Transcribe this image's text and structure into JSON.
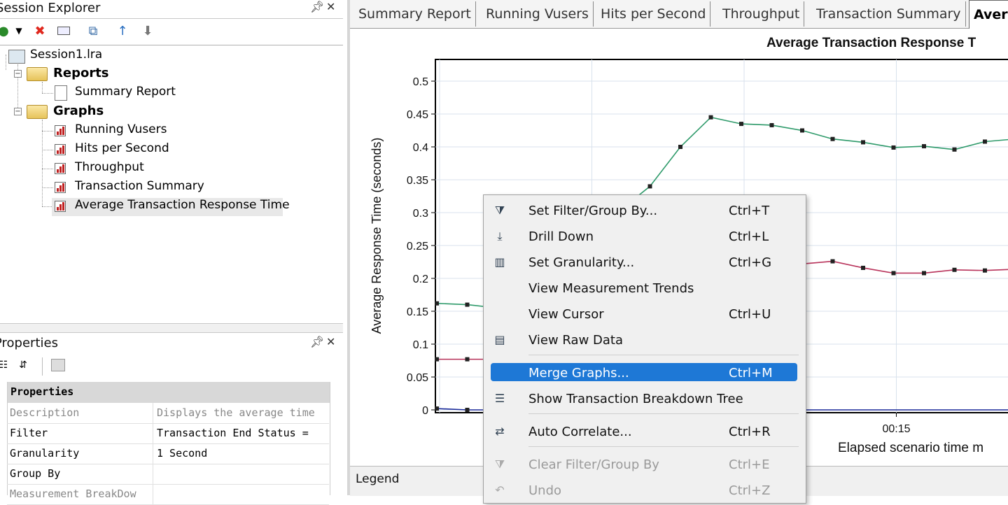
{
  "session_explorer": {
    "title": "Session Explorer",
    "tree": {
      "session": "Session1.lra",
      "reports_label": "Reports",
      "reports": [
        "Summary Report"
      ],
      "graphs_label": "Graphs",
      "graphs": [
        "Running Vusers",
        "Hits per Second",
        "Throughput",
        "Transaction Summary",
        "Average Transaction Response Time"
      ]
    }
  },
  "properties": {
    "title": "Properties",
    "group_header": "Properties",
    "rows": [
      {
        "key": "Description",
        "value": "Displays the average time",
        "dim": true
      },
      {
        "key": "Filter",
        "value": "Transaction End Status =",
        "dim": false
      },
      {
        "key": "Granularity",
        "value": "1 Second",
        "dim": false
      },
      {
        "key": "Group By",
        "value": "",
        "dim": false
      },
      {
        "key": "Measurement BreakDow",
        "value": "",
        "dim": true
      }
    ]
  },
  "tabs": [
    "Summary Report",
    "Running Vusers",
    "Hits per Second",
    "Throughput",
    "Transaction Summary",
    "Aver"
  ],
  "legend_label": "Legend",
  "context_menu": {
    "items": [
      {
        "icon": "filter-icon",
        "label": "Set Filter/Group By...",
        "shortcut": "Ctrl+T",
        "disabled": false,
        "highlight": false
      },
      {
        "icon": "drill-down-icon",
        "label": "Drill Down",
        "shortcut": "Ctrl+L",
        "disabled": false,
        "highlight": false
      },
      {
        "icon": "granularity-icon",
        "label": "Set Granularity...",
        "shortcut": "Ctrl+G",
        "disabled": false,
        "highlight": false
      },
      {
        "icon": "",
        "label": "View Measurement Trends",
        "shortcut": "",
        "disabled": false,
        "highlight": false
      },
      {
        "icon": "",
        "label": "View Cursor",
        "shortcut": "Ctrl+U",
        "disabled": false,
        "highlight": false
      },
      {
        "icon": "raw-data-icon",
        "label": "View Raw Data",
        "shortcut": "",
        "disabled": false,
        "highlight": false
      },
      {
        "icon": "",
        "label": "Merge Graphs...",
        "shortcut": "Ctrl+M",
        "disabled": false,
        "highlight": true
      },
      {
        "icon": "breakdown-tree-icon",
        "label": "Show Transaction Breakdown Tree",
        "shortcut": "",
        "disabled": false,
        "highlight": false
      },
      {
        "icon": "auto-correlate-icon",
        "label": "Auto Correlate...",
        "shortcut": "Ctrl+R",
        "disabled": false,
        "highlight": false
      },
      {
        "icon": "clear-filter-icon",
        "label": "Clear Filter/Group By",
        "shortcut": "Ctrl+E",
        "disabled": true,
        "highlight": false
      },
      {
        "icon": "undo-icon",
        "label": "Undo",
        "shortcut": "Ctrl+Z",
        "disabled": true,
        "highlight": false
      }
    ]
  },
  "chart_data": {
    "type": "line",
    "title": "Average Transaction Response T",
    "ylabel": "Average Response Time (seconds)",
    "xlabel": "Elapsed scenario time m",
    "ylim": [
      0,
      0.5
    ],
    "yticks": [
      "0",
      "0.05",
      "0.1",
      "0.15",
      "0.2",
      "0.25",
      "0.3",
      "0.35",
      "0.4",
      "0.45",
      "0.5"
    ],
    "xtick_labels": [
      {
        "t": 15,
        "label": "00:15"
      }
    ],
    "xlim": [
      0,
      19.5
    ],
    "grid": true,
    "series": [
      {
        "color": "#2e9a6a",
        "points": [
          [
            0,
            0.162
          ],
          [
            1,
            0.16
          ],
          [
            2,
            0.155
          ],
          [
            7,
            0.34
          ],
          [
            8,
            0.4
          ],
          [
            9,
            0.445
          ],
          [
            10,
            0.435
          ],
          [
            11,
            0.433
          ],
          [
            12,
            0.425
          ],
          [
            13,
            0.412
          ],
          [
            14,
            0.407
          ],
          [
            15,
            0.399
          ],
          [
            16,
            0.401
          ],
          [
            17,
            0.396
          ],
          [
            18,
            0.408
          ],
          [
            19,
            0.412
          ]
        ]
      },
      {
        "color": "#b8325a",
        "points": [
          [
            0,
            0.077
          ],
          [
            1,
            0.077
          ],
          [
            2,
            0.077
          ],
          [
            11,
            0.22
          ],
          [
            12,
            0.222
          ],
          [
            13,
            0.226
          ],
          [
            14,
            0.216
          ],
          [
            15,
            0.208
          ],
          [
            16,
            0.208
          ],
          [
            17,
            0.213
          ],
          [
            18,
            0.212
          ],
          [
            19,
            0.214
          ]
        ]
      },
      {
        "color": "#1a2a9a",
        "points": [
          [
            0,
            0.002
          ],
          [
            1,
            0.0
          ],
          [
            2,
            0.0
          ],
          [
            19,
            0.0
          ]
        ]
      }
    ]
  }
}
